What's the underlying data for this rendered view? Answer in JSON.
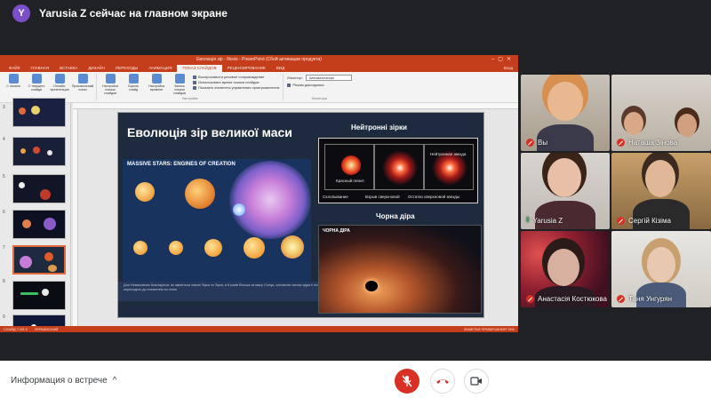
{
  "presenter": {
    "avatar_letter": "Y",
    "title": "Yarusia Z сейчас на главном экране"
  },
  "powerpoint": {
    "window_title": "Еволюція зір - Iliceis - PowerPoint (Сбой активации продукта)",
    "tabs": [
      {
        "label": "ФАЙЛ"
      },
      {
        "label": "ГЛАВНАЯ"
      },
      {
        "label": "ВСТАВКА"
      },
      {
        "label": "ДИЗАЙН"
      },
      {
        "label": "ПЕРЕХОДЫ"
      },
      {
        "label": "АНИМАЦИЯ"
      },
      {
        "label": "ПОКАЗ СЛАЙДОВ"
      },
      {
        "label": "РЕЦЕНЗИРОВАНИЕ"
      },
      {
        "label": "ВИД"
      }
    ],
    "active_tab": "ПОКАЗ СЛАЙДОВ",
    "login_label": "Вход",
    "ribbon_groups": [
      {
        "label": "Начать показ слайдов",
        "buttons": [
          {
            "label": "С начала"
          },
          {
            "label": "С текущего слайда"
          },
          {
            "label": "Онлайн-презентация"
          },
          {
            "label": "Произвольный показ"
          }
        ]
      },
      {
        "label": "Настройка",
        "buttons": [
          {
            "label": "Настройка показа слайдов"
          },
          {
            "label": "Скрыть слайд"
          },
          {
            "label": "Настройка времени"
          },
          {
            "label": "Запись показа слайдов"
          }
        ],
        "checks": [
          {
            "label": "Воспроизвести речевое сопровождение",
            "checked": true
          },
          {
            "label": "Использовать время показа слайдов",
            "checked": true
          },
          {
            "label": "Показать элементы управления проигрывателем",
            "checked": true
          }
        ]
      },
      {
        "label": "Мониторы",
        "monitor_label": "Монитор:",
        "monitor_value": "Автоматически",
        "presenter_view": "Режим докладчика"
      }
    ],
    "status_left": "СЛАЙД 7 ИЗ 9",
    "status_lang": "УКРАИНСКИЙ",
    "status_right": "ЗАМЕТКИ   ПРИМЕЧАНИЯ   76%",
    "thumb_numbers": [
      "3",
      "4",
      "5",
      "6",
      "7",
      "8",
      "9"
    ]
  },
  "slide": {
    "title": "Еволюція зір великої маси",
    "left_heading": "MASSIVE STARS: ENGINES OF CREATION",
    "caption": "Для Немасивних Аналізуючи, як зміниться значні Зірка та Зірки, в 8 разів більша за масу Сонця, основною зоною ядра є гелій та масивні уламки, хоча нуклеосинтез найбільш з 'ся переходять до елементів на гелію",
    "neutron_title": "Нейтронні зірки",
    "neutron_labels": {
      "red_giant": "Красный гигант",
      "neutron_star": "Нейтронная звезда",
      "collapse": "Схлопывание",
      "supernova": "Взрыв сверхновой",
      "remnants": "Остатки сверхновой звезды"
    },
    "blackhole_title": "Чорна діра",
    "blackhole_heading": "ЧОРНА ДІРА"
  },
  "participants": [
    {
      "name": "Вы",
      "mic": "off"
    },
    {
      "name": "Наташа Зінова",
      "mic": "off"
    },
    {
      "name": "Yarusia Z",
      "mic": "on"
    },
    {
      "name": "Сергій Кізіма",
      "mic": "off"
    },
    {
      "name": "Анастасія Костюкова",
      "mic": "off"
    },
    {
      "name": "Таня Унгурян",
      "mic": "off"
    }
  ],
  "bottombar": {
    "meeting_info": "Информация о встрече",
    "chevron": "^"
  },
  "icons": {
    "mic": "microphone-off-icon",
    "hangup": "phone-hangup-icon",
    "camera": "camera-icon"
  },
  "colors": {
    "meet_bg": "#202124",
    "pp_accent": "#c43e1c",
    "mic_off_red": "#d93025",
    "avatar_purple": "#7b4fc9"
  }
}
